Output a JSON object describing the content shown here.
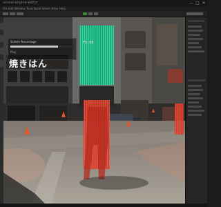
{
  "window": {
    "title_text": "unreal-engine-editor",
    "controls": [
      "—",
      "□",
      "✕"
    ]
  },
  "menubar": {
    "text": "File  Edit  Window  Tools  Build  Select  Actor  Help"
  },
  "overlay": {
    "title": "Screen Percentage",
    "progress_value": 0.75,
    "label": "Play"
  },
  "viewport": {
    "badge": "FS: 68"
  },
  "scene": {
    "sign_text": "焼きはん"
  },
  "colors": {
    "green_highlight": "#18c48a",
    "red_highlight": "#e43a2a",
    "editor_bg": "#202020",
    "panel_bg": "#252526"
  }
}
